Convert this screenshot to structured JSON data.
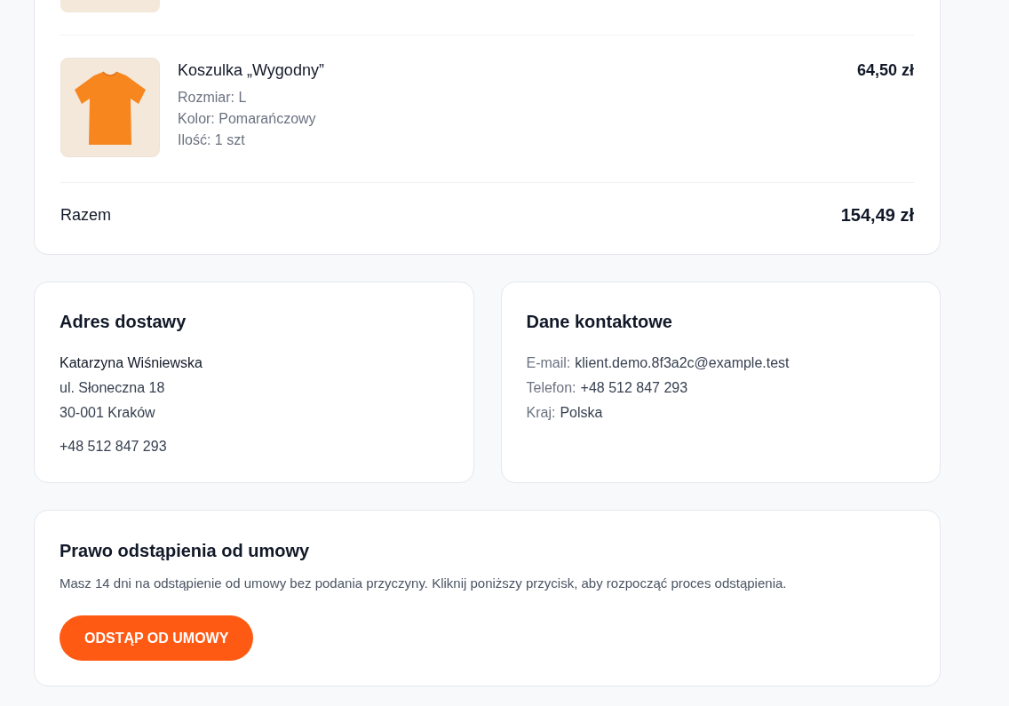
{
  "order_summary": {
    "items": [
      {
        "name": "Koszulka „Wygodny”",
        "details": [
          "Rozmiar: L",
          "Kolor: Pomarańczowy",
          "Ilość: 1 szt"
        ],
        "price": "64,50 zł"
      }
    ],
    "total_label": "Razem",
    "total": "154,49 zł"
  },
  "shipping_address": {
    "title": "Adres dostawy",
    "name": "Katarzyna Wiśniewska",
    "lines": [
      "ul. Słoneczna 18",
      "30-001 Kraków"
    ],
    "phone": "+48 512 847 293"
  },
  "contact": {
    "title": "Dane kontaktowe",
    "fields": [
      {
        "label": "E-mail:",
        "value": "klient.demo.8f3a2c@example.test"
      },
      {
        "label": "Telefon:",
        "value": "+48 512 847 293"
      },
      {
        "label": "Kraj:",
        "value": "Polska"
      }
    ]
  },
  "withdrawal": {
    "title": "Prawo odstąpienia od umowy",
    "text": "Masz 14 dni na odstąpienie od umowy bez podania przyczyny. Kliknij poniższy przycisk, aby rozpocząć proces odstąpienia.",
    "button": "ODSTĄP OD UMOWY"
  }
}
